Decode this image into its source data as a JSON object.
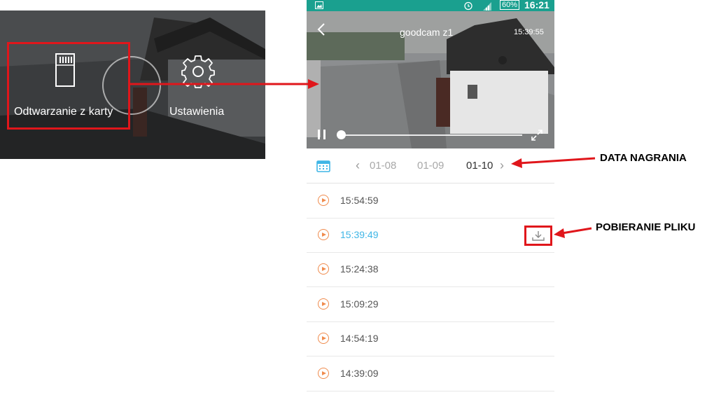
{
  "left_panel": {
    "sd_label": "Odtwarzanie z karty",
    "settings_label": "Ustawienia"
  },
  "phone": {
    "status_bar": {
      "battery": "60%",
      "clock": "16:21"
    },
    "video": {
      "camera_name": "goodcam z1",
      "timestamp": "15:39:55",
      "progress_percent": 0
    },
    "dates": {
      "prev2": "01-08",
      "prev1": "01-09",
      "current": "01-10"
    },
    "recordings": [
      {
        "time": "15:54:59",
        "active": false
      },
      {
        "time": "15:39:49",
        "active": true
      },
      {
        "time": "15:24:38",
        "active": false
      },
      {
        "time": "15:09:29",
        "active": false
      },
      {
        "time": "14:54:19",
        "active": false
      },
      {
        "time": "14:39:09",
        "active": false
      }
    ]
  },
  "annotations": {
    "date_label": "DATA NAGRANIA",
    "download_label": "POBIERANIE PLIKU"
  },
  "colors": {
    "highlight": "#e0161b",
    "status_bar": "#1aa08f",
    "accent_orange": "#f08b4d",
    "active_time": "#3fb6e6",
    "calendar": "#3fb6e6"
  }
}
